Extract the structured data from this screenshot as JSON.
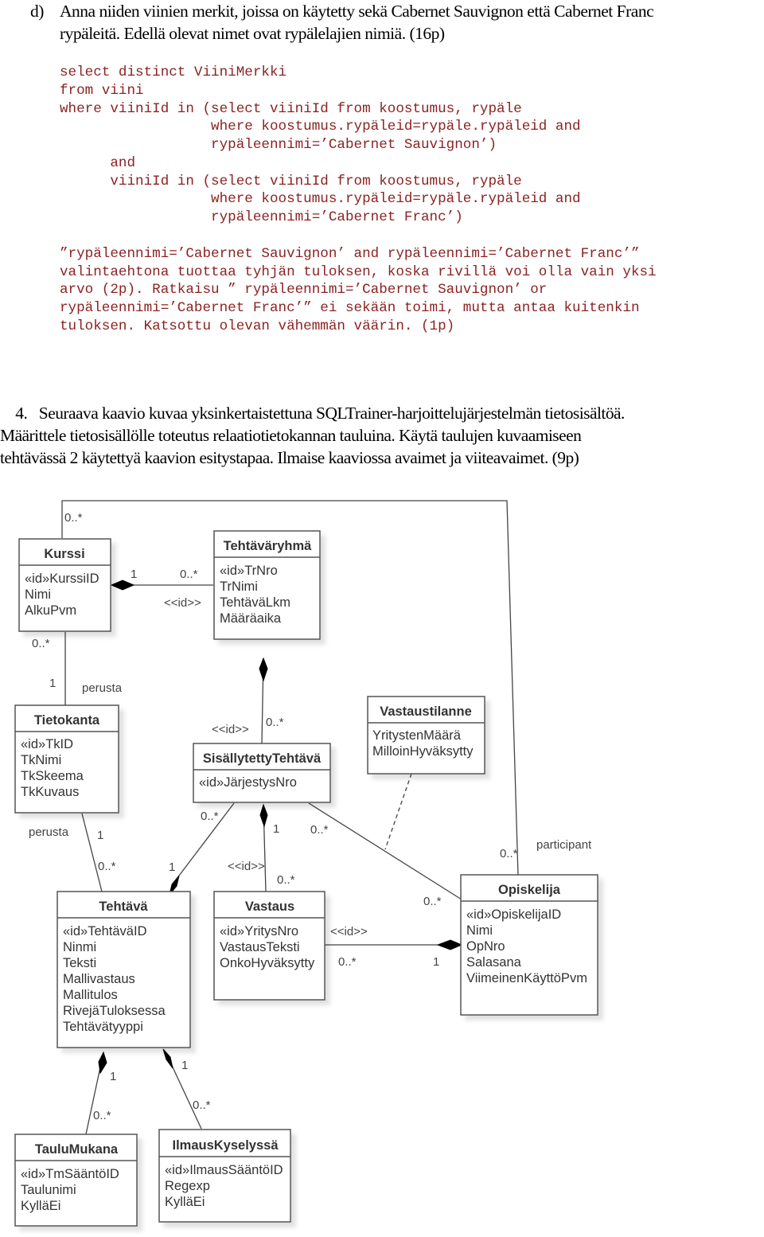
{
  "question_d": {
    "label": "d)",
    "line1": "Anna niiden viinien merkit, joissa on käytetty sekä Cabernet Sauvignon että Cabernet Franc",
    "line2": "rypäleitä. Edellä olevat nimet ovat rypälelajien nimiä.  (16p)"
  },
  "sql_answer": [
    "select distinct ViiniMerkki",
    "from viini",
    "where viiniId in (select viiniId from koostumus, rypäle",
    "                  where koostumus.rypäleid=rypäle.rypäleid and",
    "                  rypäleennimi=’Cabernet Sauvignon’)",
    "      and",
    "      viiniId in (select viiniId from koostumus, rypäle",
    "                  where koostumus.rypäleid=rypäle.rypäleid and",
    "                  rypäleennimi=’Cabernet Franc’)"
  ],
  "grading_notes": [
    "”rypäleennimi=’Cabernet Sauvignon’ and rypäleennimi=’Cabernet Franc’”",
    "valintaehtona tuottaa tyhjän tuloksen, koska rivillä voi olla vain yksi",
    "arvo (2p). Ratkaisu ” rypäleennimi=’Cabernet Sauvignon’ or",
    "rypäleennimi=’Cabernet Franc’” ei sekään toimi, mutta antaa kuitenkin",
    "tuloksen. Katsottu olevan vähemmän väärin. (1p)"
  ],
  "question_4": {
    "line1": "    4.   Seuraava kaavio kuvaa yksinkertaistettuna SQLTrainer-harjoittelujärjestelmän tietosisältöä.",
    "line2": "Määrittele tietosisällölle toteutus relaatiotietokannan tauluina. Käytä taulujen kuvaamiseen",
    "line3": "tehtävässä 2  käytettyä kaavion esitystapaa. Ilmaise kaaviossa avaimet ja viiteavaimet. (9p)"
  },
  "diagram": {
    "classes": {
      "kurssi": {
        "name": "Kurssi",
        "attributes": [
          "«id»KurssiID",
          "Nimi",
          "AlkuPvm"
        ]
      },
      "tehtavaryhma": {
        "name": "Tehtäväryhmä",
        "attributes": [
          "«id»TrNro",
          "TrNimi",
          "TehtäväLkm",
          "Määräaika"
        ]
      },
      "tietokanta": {
        "name": "Tietokanta",
        "attributes": [
          "«id»TkID",
          "TkNimi",
          "TkSkeema",
          "TkKuvaus"
        ]
      },
      "sisallytetty": {
        "name": "SisällytettyTehtävä",
        "attributes": [
          "«id»JärjestysNro"
        ]
      },
      "vastaustilanne": {
        "name": "Vastaustilanne",
        "attributes": [
          "YritystenMäärä",
          "MilloinHyväksytty"
        ]
      },
      "tehtava": {
        "name": "Tehtävä",
        "attributes": [
          "«id»TehtäväID",
          "Ninmi",
          "Teksti",
          "Mallivastaus",
          "Mallitulos",
          "RivejäTuloksessa",
          "Tehtävätyyppi"
        ]
      },
      "vastaus": {
        "name": "Vastaus",
        "attributes": [
          "«id»YritysNro",
          "VastausTeksti",
          "OnkoHyväksytty"
        ]
      },
      "opiskelija": {
        "name": "Opiskelija",
        "attributes": [
          "«id»OpiskelijaID",
          "Nimi",
          "OpNro",
          "Salasana",
          "ViimeinenKäyttöPvm"
        ]
      },
      "taulumukana": {
        "name": "TauluMukana",
        "attributes": [
          "«id»TmSääntöID",
          "Taulunimi",
          "KylläEi"
        ]
      },
      "ilmaus": {
        "name": "IlmausKyselyssä",
        "attributes": [
          "«id»IlmausSääntöID",
          "Regexp",
          "KylläEi"
        ]
      }
    },
    "labels": {
      "kurssi_top": "0..*",
      "kurssi_tr_1": "1",
      "kurssi_tr_many": "0..*",
      "kurssi_tr_id": "<<id>>",
      "kurssi_tk_many": "0..*",
      "kurssi_tk_1": "1",
      "kurssi_tk_role": "perusta",
      "tr_st_id": "<<id>>",
      "tr_st_many": "0..*",
      "tk_teh_role": "perusta",
      "tk_teh_1": "1",
      "tk_teh_many": "0..*",
      "st_teh_many": "0..*",
      "st_teh_1": "1",
      "st_vas_1": "1",
      "st_vas_id": "<<id>>",
      "st_vas_many": "0..*",
      "st_op_many": "0..*",
      "op_part_many": "0..*",
      "op_part_role": "participant",
      "st_op_many2": "0..*",
      "vas_op_id": "<<id>>",
      "vas_op_many": "0..*",
      "vas_op_1": "1",
      "teh_tm_1": "1",
      "teh_tm_many": "0..*",
      "teh_il_1": "1",
      "teh_il_many": "0..*"
    }
  }
}
